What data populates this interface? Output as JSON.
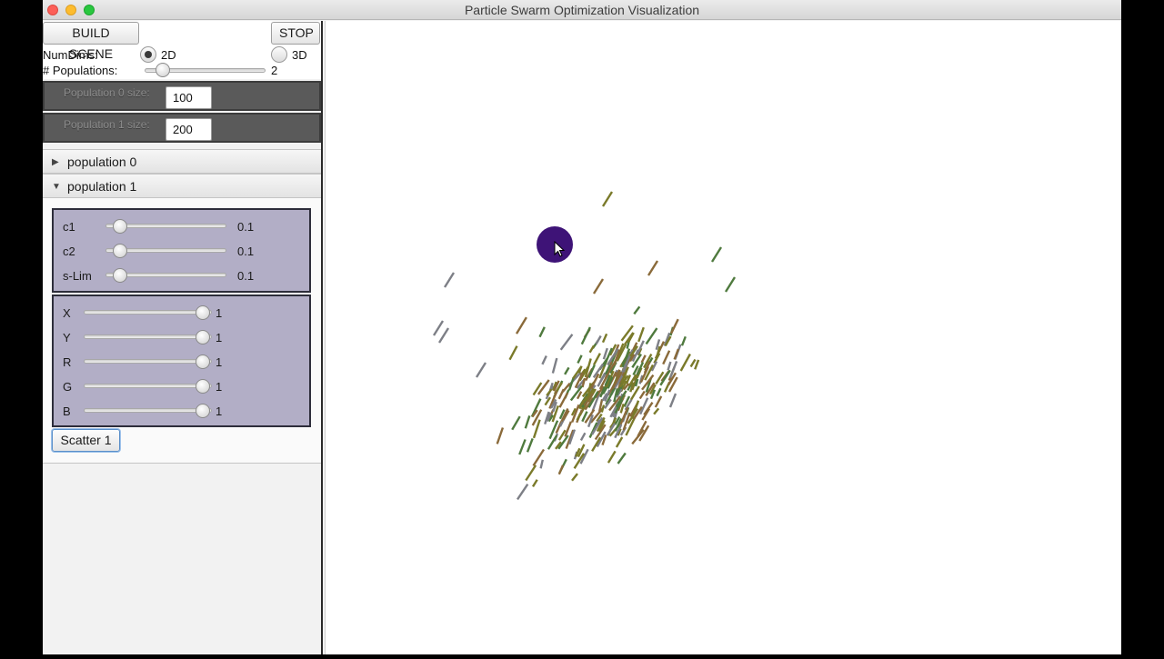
{
  "window": {
    "title": "Particle Swarm Optimization Visualization"
  },
  "controls": {
    "build_label": "BUILD SCENE",
    "stop_label": "STOP",
    "numdims_label": "NumDims:",
    "option_2d": "2D",
    "option_3d": "3D",
    "selected_dims": "2D",
    "populations_label": "# Populations:",
    "populations_value": "2",
    "populations_slider_fraction": 0.1
  },
  "population_sizes": [
    {
      "label": "Population 0 size:",
      "value": "100"
    },
    {
      "label": "Population 1 size:",
      "value": "200"
    }
  ],
  "panes": [
    {
      "label": "population 0",
      "expanded": false
    },
    {
      "label": "population 1",
      "expanded": true
    }
  ],
  "params": [
    {
      "label": "c1",
      "value": "0.1",
      "fraction": 0.1
    },
    {
      "label": "c2",
      "value": "0.1",
      "fraction": 0.1
    },
    {
      "label": "s-Lim",
      "value": "0.1",
      "fraction": 0.1
    }
  ],
  "axes": [
    {
      "label": "X",
      "value": "1",
      "fraction": 1
    },
    {
      "label": "Y",
      "value": "1",
      "fraction": 1
    },
    {
      "label": "R",
      "value": "1",
      "fraction": 1
    },
    {
      "label": "G",
      "value": "1",
      "fraction": 1
    },
    {
      "label": "B",
      "value": "1",
      "fraction": 1
    }
  ],
  "scatter_label": "Scatter 1",
  "colors": {
    "cursor_dot": "#3e1377",
    "particle_olive": "#7a7a2a",
    "particle_green": "#4f7a3e",
    "particle_gray": "#7d7f86",
    "particle_brown": "#8a6a3a"
  }
}
